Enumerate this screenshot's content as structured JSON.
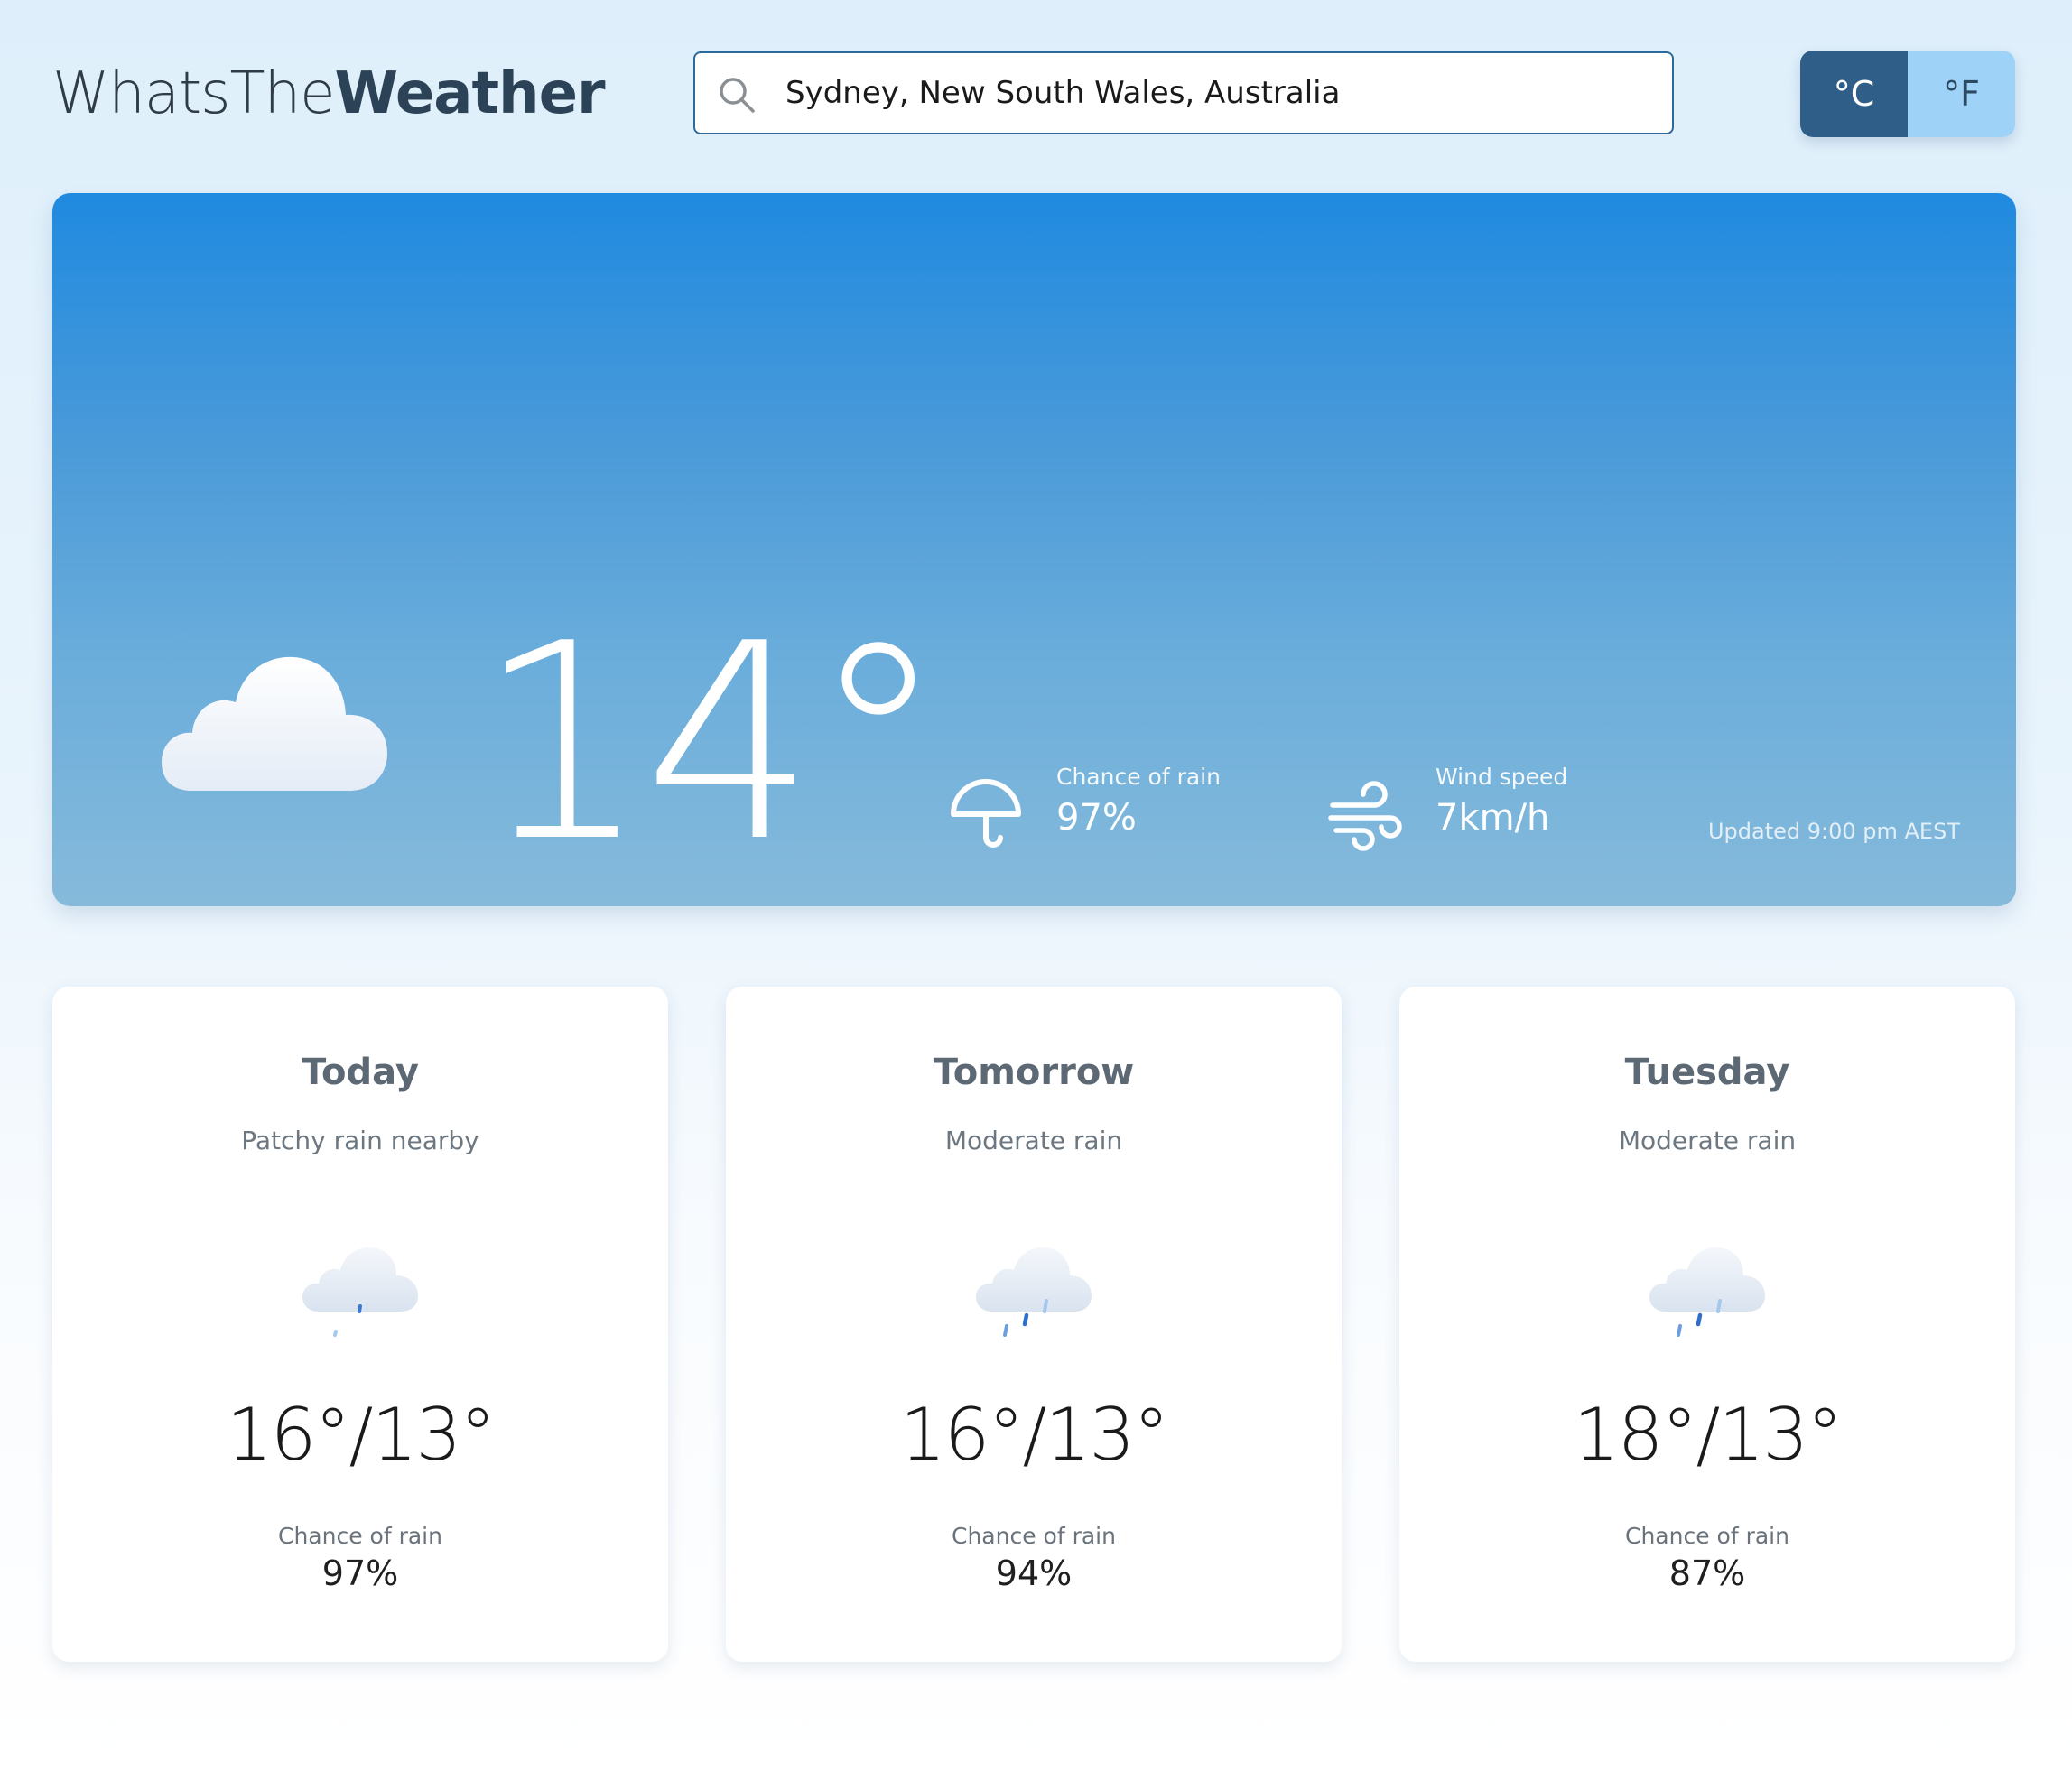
{
  "brand": {
    "light": "WhatsThe",
    "bold": "Weather"
  },
  "search": {
    "value": "Sydney, New South Wales, Australia",
    "icon": "search-icon"
  },
  "units": {
    "celsius": "°C",
    "fahrenheit": "°F",
    "active": "celsius"
  },
  "current": {
    "temperature": "14°",
    "icon": "cloudy-night-icon",
    "rain_label": "Chance of rain",
    "rain_value": "97%",
    "rain_icon": "umbrella-icon",
    "wind_label": "Wind speed",
    "wind_value": "7km/h",
    "wind_icon": "wind-icon",
    "updated": "Updated 9:00 pm AEST"
  },
  "forecast": [
    {
      "day": "Today",
      "condition": "Patchy rain nearby",
      "temps": "16°/13°",
      "rain_label": "Chance of rain",
      "rain_value": "97%",
      "icon": "light-rain-cloud-icon"
    },
    {
      "day": "Tomorrow",
      "condition": "Moderate rain",
      "temps": "16°/13°",
      "rain_label": "Chance of rain",
      "rain_value": "94%",
      "icon": "rain-cloud-icon"
    },
    {
      "day": "Tuesday",
      "condition": "Moderate rain",
      "temps": "18°/13°",
      "rain_label": "Chance of rain",
      "rain_value": "87%",
      "icon": "rain-cloud-icon"
    }
  ],
  "colors": {
    "accent": "#2f5f88",
    "toggle_inactive": "#9ed3f7",
    "hero_top": "#1f8ae0",
    "hero_bottom": "#86badb"
  }
}
